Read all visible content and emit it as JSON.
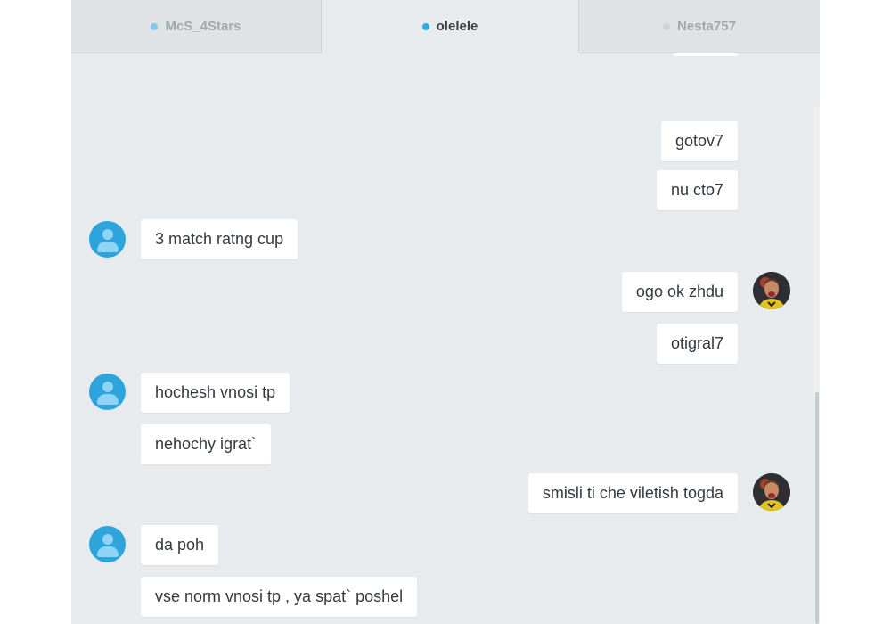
{
  "tabs": [
    {
      "label": "McS_4Stars",
      "dot_color": "#7fcbe9"
    },
    {
      "label": "olelele",
      "dot_color": "#2eaae1"
    },
    {
      "label": "Nesta757",
      "dot_color": "#cfd3d6"
    }
  ],
  "messages": [
    {
      "side": "right",
      "text": "gotov7"
    },
    {
      "side": "right",
      "text": "nu cto7"
    },
    {
      "side": "left",
      "text": "3 match ratng cup"
    },
    {
      "side": "right",
      "text": "ogo ok zhdu"
    },
    {
      "side": "right",
      "text": "otigral7"
    },
    {
      "side": "left",
      "text": "hochesh vnosi tp"
    },
    {
      "side": "left",
      "text": "nehochy igrat`"
    },
    {
      "side": "right",
      "text": "smisli ti che viletish togda"
    },
    {
      "side": "left",
      "text": "da poh"
    },
    {
      "side": "left",
      "text": "vse norm vnosi tp , ya spat` poshel"
    }
  ],
  "icons": {
    "default_avatar": "user-icon",
    "photo_avatar": "user-photo"
  }
}
